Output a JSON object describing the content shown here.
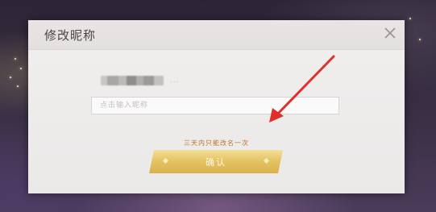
{
  "dialog": {
    "title": "修改昵称",
    "username_suffix": "...",
    "input_placeholder": "点击输入昵称",
    "hint": "三天内只能改名一次",
    "confirm_label": "确认",
    "close_icon": "close-icon"
  },
  "colors": {
    "hint": "#c0722a",
    "button_gold": "#e6c463",
    "annotation_arrow": "#e0302a"
  }
}
